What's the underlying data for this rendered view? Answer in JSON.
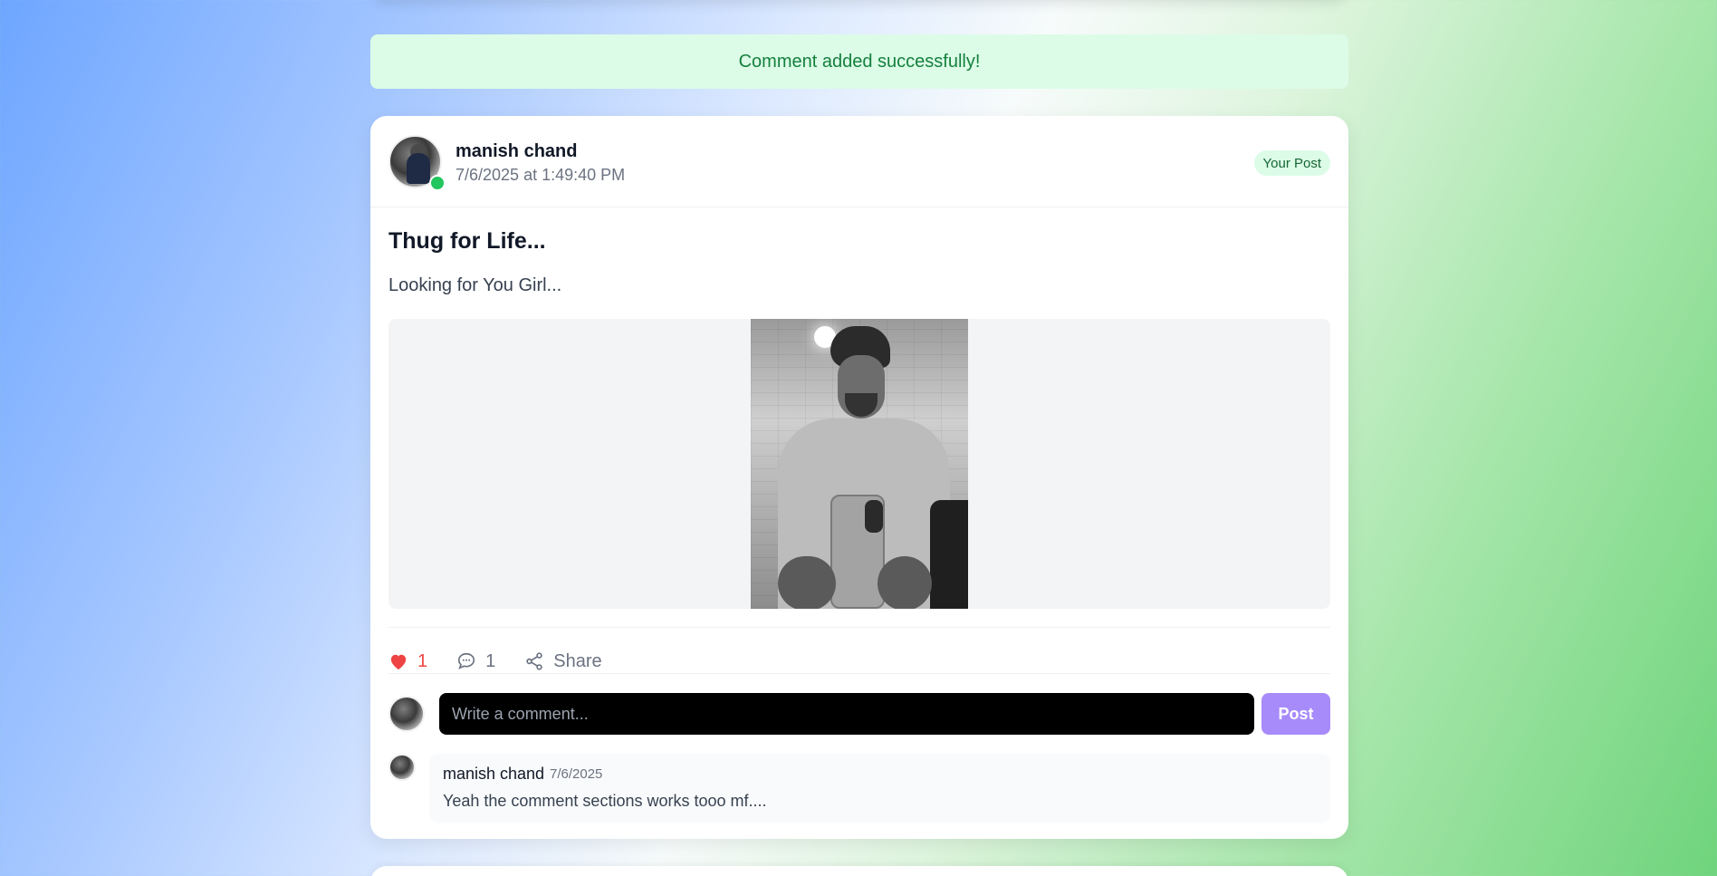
{
  "toast": {
    "message": "Comment added successfully!"
  },
  "post": {
    "author": "manish chand",
    "timestamp": "7/6/2025 at 1:49:40 PM",
    "badge": "Your Post",
    "title": "Thug for Life...",
    "body": "Looking for You Girl...",
    "likes": "1",
    "comments_count": "1",
    "share_label": "Share"
  },
  "comment_form": {
    "placeholder": "Write a comment...",
    "submit_label": "Post"
  },
  "comments": [
    {
      "author": "manish chand",
      "date": "7/6/2025",
      "text": "Yeah the comment sections works tooo mf...."
    }
  ],
  "colors": {
    "toast_bg": "#dcfce7",
    "toast_text": "#15803d",
    "like": "#ef4444",
    "online": "#22c55e",
    "post_button": "#a78bfa"
  },
  "icons": {
    "like": "heart-icon",
    "comment": "chat-bubble-icon",
    "share": "share-icon"
  }
}
